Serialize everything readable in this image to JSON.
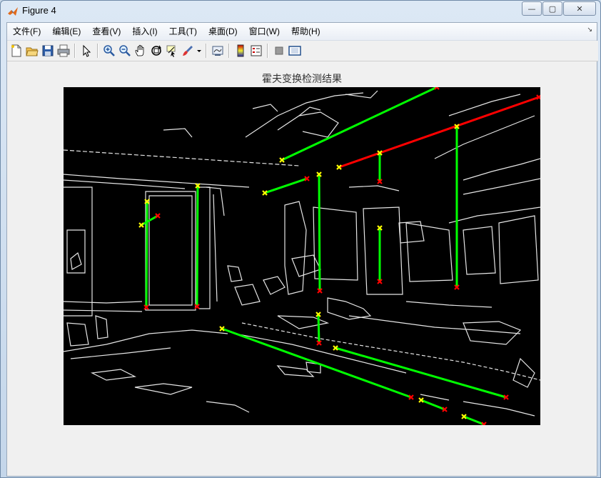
{
  "window": {
    "title": "Figure 4",
    "buttons": {
      "minimize": "—",
      "maximize": "▢",
      "close": "✕"
    }
  },
  "menubar": {
    "items": [
      "文件(F)",
      "编辑(E)",
      "查看(V)",
      "插入(I)",
      "工具(T)",
      "桌面(D)",
      "窗口(W)",
      "帮助(H)"
    ],
    "dock_arrow": "↘"
  },
  "toolbar": {
    "icons": [
      "new-figure-icon",
      "open-file-icon",
      "save-icon",
      "print-icon",
      "edit-plot-arrow-icon",
      "zoom-in-icon",
      "zoom-out-icon",
      "pan-hand-icon",
      "rotate-3d-icon",
      "data-cursor-icon",
      "brush-icon",
      "brush-dropdown-icon",
      "link-plot-icon",
      "colorbar-icon",
      "legend-icon",
      "hide-plot-tools-icon",
      "show-plot-tools-icon"
    ]
  },
  "figure": {
    "title": "霍夫变换检测结果",
    "colors": {
      "line_green": "#00ff00",
      "line_red": "#ff0000",
      "start_marker": "#ffff00",
      "end_marker": "#ff0000",
      "edges": "#ffffff",
      "background": "#000000"
    }
  }
}
